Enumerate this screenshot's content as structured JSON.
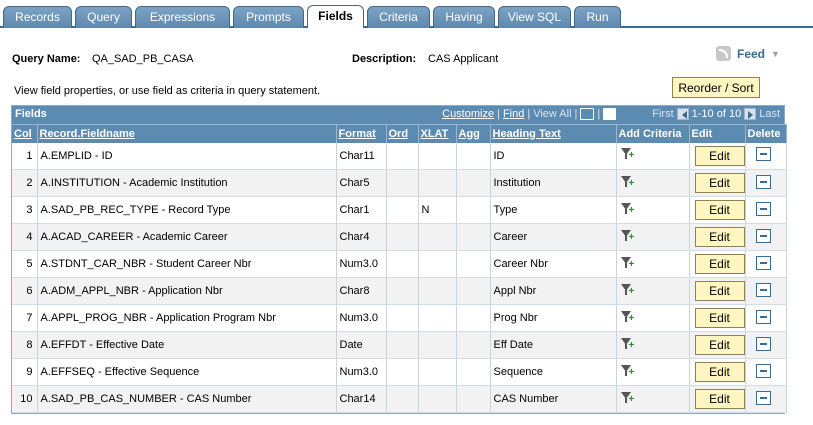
{
  "tabs": [
    {
      "label": "Records",
      "active": false
    },
    {
      "label": "Query",
      "active": false
    },
    {
      "label": "Expressions",
      "active": false
    },
    {
      "label": "Prompts",
      "active": false
    },
    {
      "label": "Fields",
      "active": true
    },
    {
      "label": "Criteria",
      "active": false
    },
    {
      "label": "Having",
      "active": false
    },
    {
      "label": "View SQL",
      "active": false
    },
    {
      "label": "Run",
      "active": false
    }
  ],
  "header": {
    "query_name_label": "Query Name:",
    "query_name": "QA_SAD_PB_CASA",
    "description_label": "Description:",
    "description": "CAS Applicant",
    "feed_label": "Feed",
    "reorder_label": "Reorder / Sort",
    "instructions": "View field properties, or use field as criteria in query statement."
  },
  "grid": {
    "title": "Fields",
    "nav": {
      "customize": "Customize",
      "find": "Find",
      "view_all": "View All",
      "first": "First",
      "range": "1-10 of 10",
      "last": "Last"
    },
    "columns": [
      "Col",
      "Record.Fieldname",
      "Format",
      "Ord",
      "XLAT",
      "Agg",
      "Heading Text",
      "Add Criteria",
      "Edit",
      "Delete"
    ],
    "edit_label": "Edit",
    "rows": [
      {
        "col": "1",
        "field": "A.EMPLID - ID",
        "format": "Char11",
        "ord": "",
        "xlat": "",
        "agg": "",
        "heading": "ID"
      },
      {
        "col": "2",
        "field": "A.INSTITUTION - Academic Institution",
        "format": "Char5",
        "ord": "",
        "xlat": "",
        "agg": "",
        "heading": "Institution"
      },
      {
        "col": "3",
        "field": "A.SAD_PB_REC_TYPE - Record Type",
        "format": "Char1",
        "ord": "",
        "xlat": "N",
        "agg": "",
        "heading": "Type"
      },
      {
        "col": "4",
        "field": "A.ACAD_CAREER - Academic Career",
        "format": "Char4",
        "ord": "",
        "xlat": "",
        "agg": "",
        "heading": "Career"
      },
      {
        "col": "5",
        "field": "A.STDNT_CAR_NBR - Student Career Nbr",
        "format": "Num3.0",
        "ord": "",
        "xlat": "",
        "agg": "",
        "heading": "Career Nbr"
      },
      {
        "col": "6",
        "field": "A.ADM_APPL_NBR - Application Nbr",
        "format": "Char8",
        "ord": "",
        "xlat": "",
        "agg": "",
        "heading": "Appl Nbr"
      },
      {
        "col": "7",
        "field": "A.APPL_PROG_NBR - Application Program Nbr",
        "format": "Num3.0",
        "ord": "",
        "xlat": "",
        "agg": "",
        "heading": "Prog Nbr"
      },
      {
        "col": "8",
        "field": "A.EFFDT - Effective Date",
        "format": "Date",
        "ord": "",
        "xlat": "",
        "agg": "",
        "heading": "Eff Date"
      },
      {
        "col": "9",
        "field": "A.EFFSEQ - Effective Sequence",
        "format": "Num3.0",
        "ord": "",
        "xlat": "",
        "agg": "",
        "heading": "Sequence"
      },
      {
        "col": "10",
        "field": "A.SAD_PB_CAS_NUMBER - CAS Number",
        "format": "Char14",
        "ord": "",
        "xlat": "",
        "agg": "",
        "heading": "CAS Number"
      }
    ]
  }
}
